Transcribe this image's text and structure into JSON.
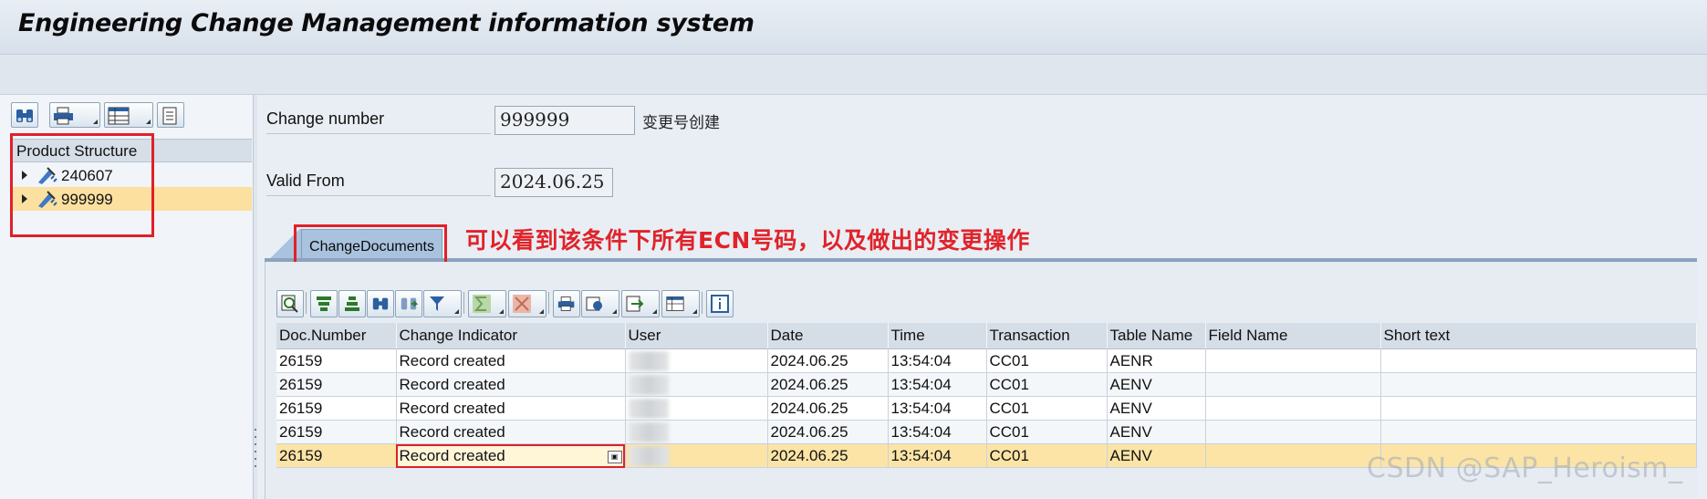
{
  "window": {
    "title": "Engineering Change Management information system"
  },
  "left_toolbar": {
    "buttons": [
      {
        "icon": "binoculars-icon"
      },
      {
        "icon": "print-icon",
        "dropdown": true
      },
      {
        "icon": "layout-icon",
        "dropdown": true
      },
      {
        "icon": "document-icon"
      }
    ]
  },
  "tree": {
    "header": "Product Structure",
    "items": [
      {
        "label": "240607",
        "icon": "change-number-icon",
        "selected": false
      },
      {
        "label": "999999",
        "icon": "change-number-icon",
        "selected": true
      }
    ]
  },
  "form": {
    "change_number_label": "Change number",
    "change_number_value": "999999",
    "change_number_desc": "变更号创建",
    "valid_from_label": "Valid From",
    "valid_from_value": "2024.06.25"
  },
  "tabs": [
    {
      "label": "ChangeDocuments",
      "active": true
    }
  ],
  "annotation": "可以看到该条件下所有ECN号码，以及做出的变更操作",
  "grid": {
    "columns": [
      "Doc.Number",
      "Change Indicator",
      "User",
      "Date",
      "Time",
      "Transaction",
      "Table Name",
      "Field Name",
      "Short text"
    ],
    "rows": [
      {
        "doc": "26159",
        "indicator": "Record created",
        "user": "",
        "date": "2024.06.25",
        "time": "13:54:04",
        "transaction": "CC01",
        "table": "AENR",
        "field": "",
        "short": ""
      },
      {
        "doc": "26159",
        "indicator": "Record created",
        "user": "",
        "date": "2024.06.25",
        "time": "13:54:04",
        "transaction": "CC01",
        "table": "AENV",
        "field": "",
        "short": ""
      },
      {
        "doc": "26159",
        "indicator": "Record created",
        "user": "",
        "date": "2024.06.25",
        "time": "13:54:04",
        "transaction": "CC01",
        "table": "AENV",
        "field": "",
        "short": ""
      },
      {
        "doc": "26159",
        "indicator": "Record created",
        "user": "",
        "date": "2024.06.25",
        "time": "13:54:04",
        "transaction": "CC01",
        "table": "AENV",
        "field": "",
        "short": ""
      },
      {
        "doc": "26159",
        "indicator": "Record created",
        "user": "",
        "date": "2024.06.25",
        "time": "13:54:04",
        "transaction": "CC01",
        "table": "AENV",
        "field": "",
        "short": ""
      }
    ],
    "selected_row": 4
  },
  "watermark": "CSDN @SAP_Heroism_",
  "colors": {
    "selection": "#fbe4a6",
    "annotation_red": "#e0232a",
    "tab_blue": "#a9c3df"
  }
}
